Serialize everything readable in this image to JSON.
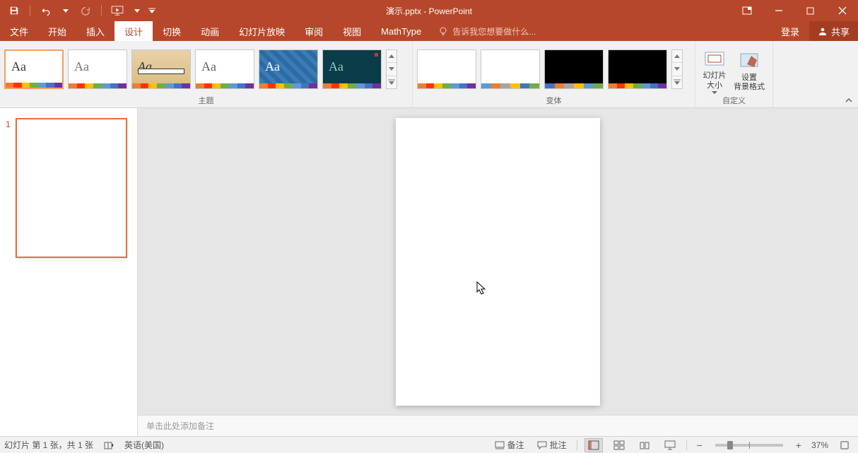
{
  "app": {
    "title": "演示.pptx - PowerPoint"
  },
  "qat": {
    "save": "保存",
    "undo": "撤销",
    "redo": "重做",
    "start": "从头开始"
  },
  "window": {
    "account": "登录",
    "share": "共享"
  },
  "tabs": {
    "file": "文件",
    "home": "开始",
    "insert": "插入",
    "design": "设计",
    "transitions": "切换",
    "animations": "动画",
    "slideshow": "幻灯片放映",
    "review": "审阅",
    "view": "视图",
    "mathtype": "MathType",
    "tellme_placeholder": "告诉我您想要做什么..."
  },
  "ribbon": {
    "themes_label": "主题",
    "variants_label": "变体",
    "customize_label": "自定义",
    "slide_size": "幻灯片\n大小",
    "format_bg": "设置\n背景格式",
    "theme_colors": {
      "full": [
        "#ed7d31",
        "#ff3300",
        "#ffc000",
        "#70ad47",
        "#5b9bd5",
        "#4472c4",
        "#7030a0"
      ],
      "off1": [
        "#5b9bd5",
        "#ed7d31",
        "#a5a5a5",
        "#ffc000",
        "#4472c4",
        "#70ad47"
      ],
      "off2": [
        "#4472c4",
        "#ed7d31",
        "#a5a5a5",
        "#ffc000",
        "#5b9bd5",
        "#70ad47"
      ]
    }
  },
  "slidepane": {
    "slide_number": "1"
  },
  "notes": {
    "placeholder": "单击此处添加备注"
  },
  "status": {
    "slide_info": "幻灯片 第 1 张，共 1 张",
    "language": "英语(美国)",
    "notes_btn": "备注",
    "comments_btn": "批注",
    "zoom_pct": "37%"
  }
}
